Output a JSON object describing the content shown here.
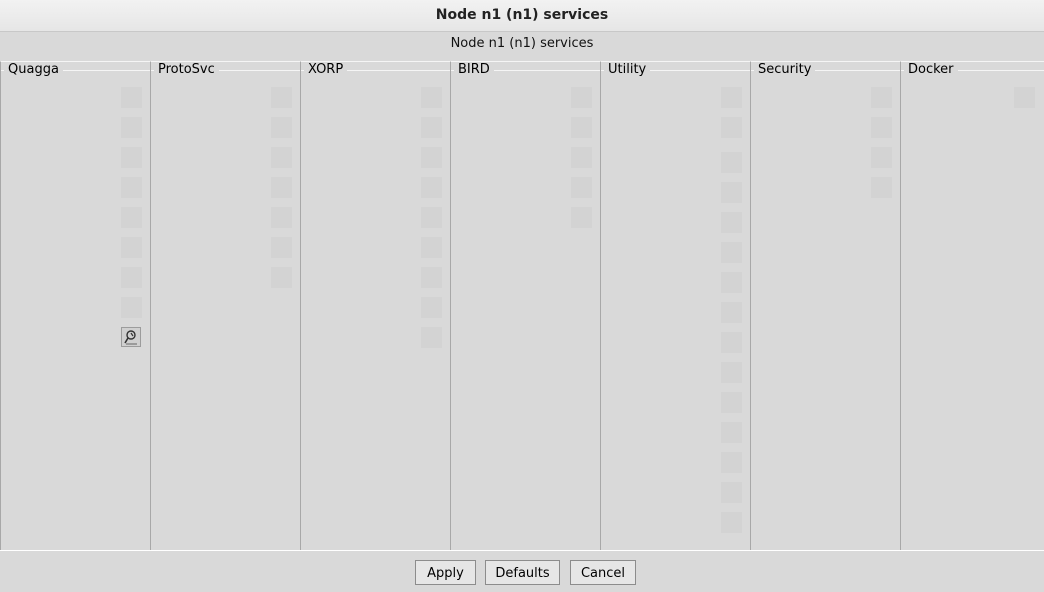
{
  "window": {
    "title": "Node n1 (n1) services"
  },
  "header": {
    "label": "Node n1 (n1) services"
  },
  "groups": [
    {
      "name": "Quagga",
      "service_count": 9,
      "configured_icon_index": 8
    },
    {
      "name": "ProtoSvc",
      "service_count": 7
    },
    {
      "name": "XORP",
      "service_count": 9
    },
    {
      "name": "BIRD",
      "service_count": 5
    },
    {
      "name": "Utility",
      "service_count": 15
    },
    {
      "name": "Security",
      "service_count": 4
    },
    {
      "name": "Docker",
      "service_count": 1
    }
  ],
  "icons": {
    "configured": "wrench-config-icon"
  },
  "buttons": {
    "apply": "Apply",
    "defaults": "Defaults",
    "cancel": "Cancel"
  }
}
